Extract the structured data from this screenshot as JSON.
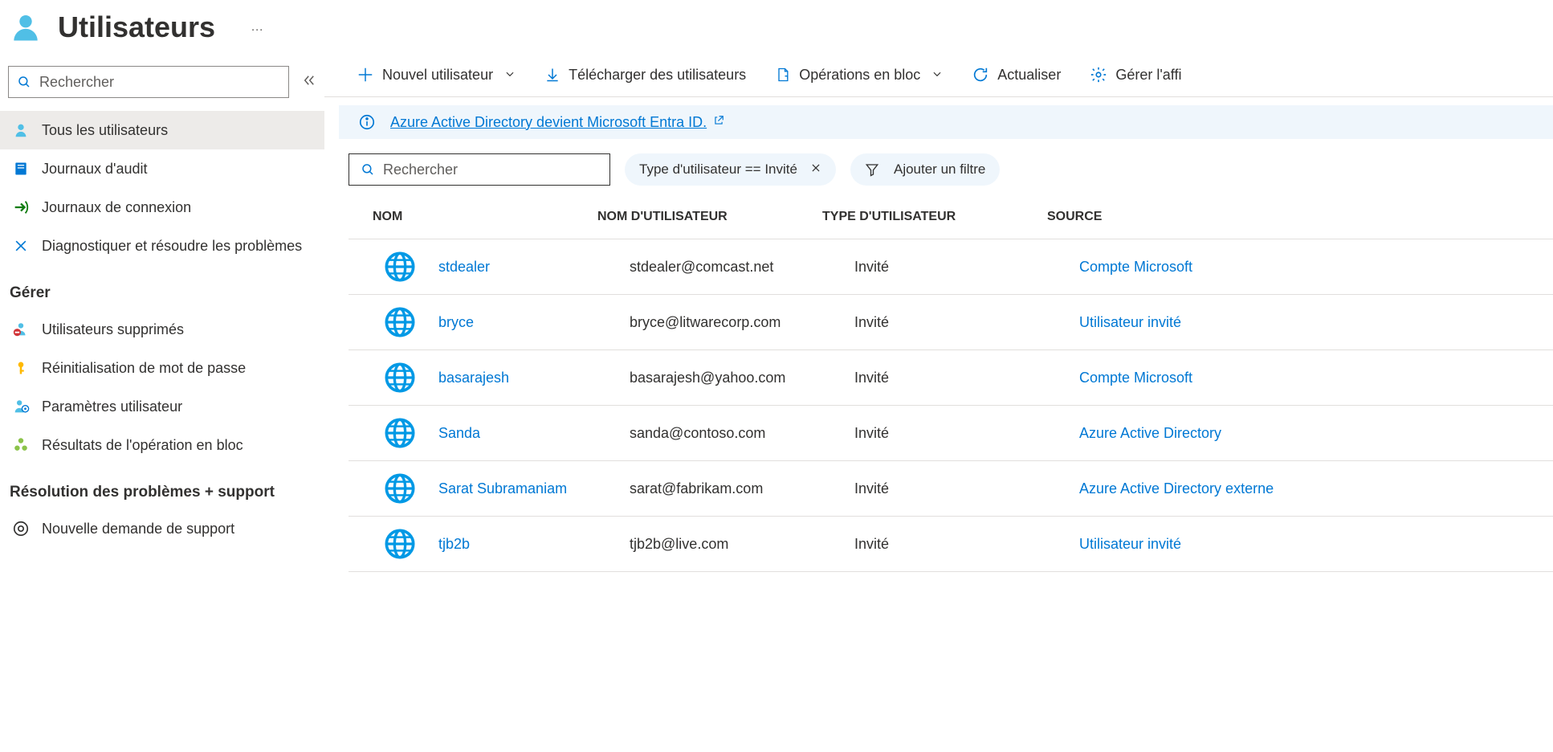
{
  "header": {
    "title": "Utilisateurs",
    "more": "…"
  },
  "sidebar": {
    "search_placeholder": "Rechercher",
    "nav": {
      "all_users": "Tous les utilisateurs",
      "audit_logs": "Journaux d'audit",
      "signin_logs": "Journaux de connexion",
      "diagnose": "Diagnostiquer et résoudre les problèmes"
    },
    "manage_heading": "Gérer",
    "manage": {
      "deleted_users": "Utilisateurs supprimés",
      "password_reset": "Réinitialisation de mot de passe",
      "user_settings": "Paramètres utilisateur",
      "bulk_results": "Résultats de l'opération en bloc"
    },
    "support_heading": "Résolution des problèmes + support",
    "support": {
      "new_request": "Nouvelle demande de support"
    }
  },
  "toolbar": {
    "new_user": "Nouvel utilisateur",
    "download": "Télécharger des utilisateurs",
    "bulk_ops": "Opérations en bloc",
    "refresh": "Actualiser",
    "manage_view": "Gérer l'affi"
  },
  "banner": {
    "text": "Azure Active Directory devient Microsoft Entra ID."
  },
  "filters": {
    "search_placeholder": "Rechercher",
    "type_filter": "Type d'utilisateur == Invité",
    "add_filter": "Ajouter un filtre"
  },
  "table": {
    "headers": {
      "name": "NOM",
      "username": "NOM D'UTILISATEUR",
      "type": "TYPE D'UTILISATEUR",
      "source": "SOURCE"
    },
    "rows": [
      {
        "name": "stdealer",
        "username": "stdealer@comcast.net",
        "type": "Invité",
        "source": "Compte Microsoft"
      },
      {
        "name": "bryce",
        "username": "bryce@litwarecorp.com",
        "type": "Invité",
        "source": "Utilisateur invité"
      },
      {
        "name": "basarajesh",
        "username": "basarajesh@yahoo.com",
        "type": "Invité",
        "source": "Compte Microsoft"
      },
      {
        "name": "Sanda",
        "username": "sanda@contoso.com",
        "type": "Invité",
        "source": "Azure Active Directory"
      },
      {
        "name": "Sarat Subramaniam",
        "username": "sarat@fabrikam.com",
        "type": "Invité",
        "source": "Azure Active Directory externe"
      },
      {
        "name": "tjb2b",
        "username": "tjb2b@live.com",
        "type": "Invité",
        "source": "Utilisateur invité"
      }
    ]
  }
}
